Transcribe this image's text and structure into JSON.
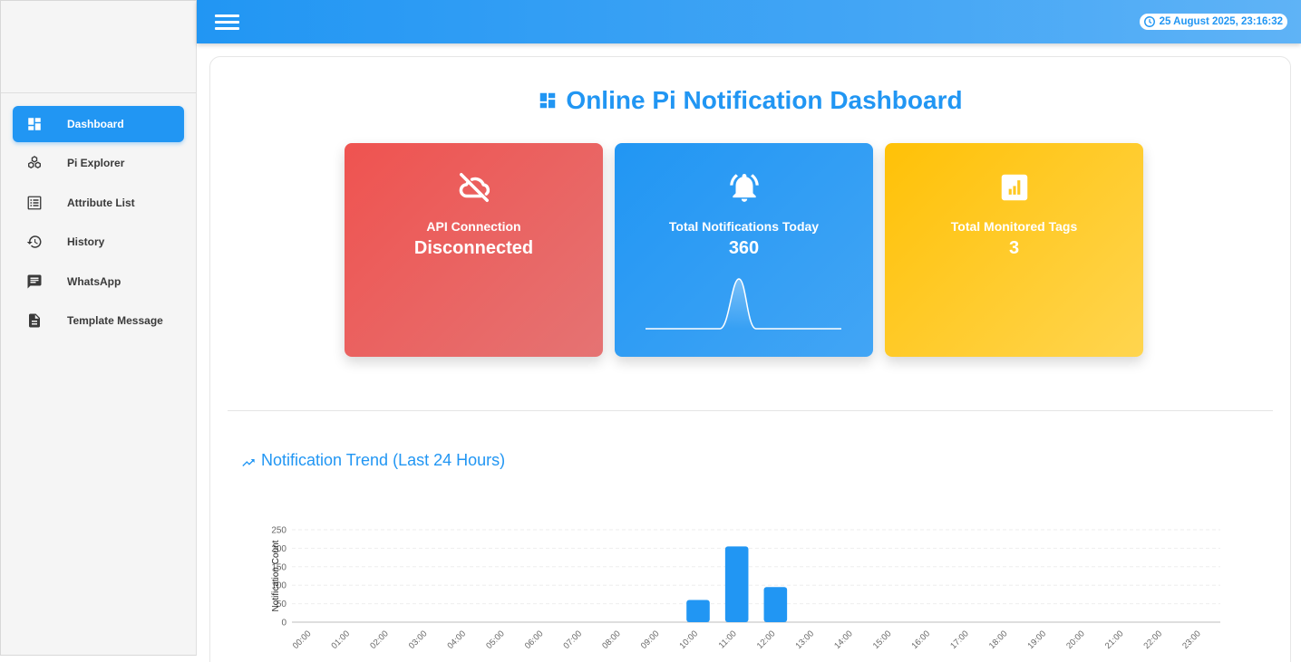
{
  "sidebar": {
    "items": [
      {
        "label": "Dashboard",
        "icon": "dashboard-icon",
        "active": true
      },
      {
        "label": "Pi Explorer",
        "icon": "hexagons-icon",
        "active": false
      },
      {
        "label": "Attribute List",
        "icon": "list-icon",
        "active": false
      },
      {
        "label": "History",
        "icon": "history-icon",
        "active": false
      },
      {
        "label": "WhatsApp",
        "icon": "chat-icon",
        "active": false
      },
      {
        "label": "Template Message",
        "icon": "document-icon",
        "active": false
      }
    ]
  },
  "topbar": {
    "datetime": "25 August 2025, 23:16:32"
  },
  "main": {
    "title": "Online Pi Notification Dashboard",
    "cards": {
      "api": {
        "label": "API Connection",
        "value": "Disconnected",
        "color": "#ef5350"
      },
      "notifications": {
        "label": "Total Notifications Today",
        "value": "360",
        "color": "#2196f3"
      },
      "tags": {
        "label": "Total Monitored Tags",
        "value": "3",
        "color": "#ffc107"
      }
    },
    "trend_title": "Notification Trend (Last 24 Hours)"
  },
  "chart_data": {
    "type": "bar",
    "title": "Notification Trend (Last 24 Hours)",
    "xlabel": "",
    "ylabel": "Notification Count",
    "ylim": [
      0,
      250
    ],
    "yticks": [
      0,
      50,
      100,
      150,
      200,
      250
    ],
    "categories": [
      "00:00",
      "01:00",
      "02:00",
      "03:00",
      "04:00",
      "05:00",
      "06:00",
      "07:00",
      "08:00",
      "09:00",
      "10:00",
      "11:00",
      "12:00",
      "13:00",
      "14:00",
      "15:00",
      "16:00",
      "17:00",
      "18:00",
      "19:00",
      "20:00",
      "21:00",
      "22:00",
      "23:00"
    ],
    "values": [
      0,
      0,
      0,
      0,
      0,
      0,
      0,
      0,
      0,
      0,
      60,
      205,
      95,
      0,
      0,
      0,
      0,
      0,
      0,
      0,
      0,
      0,
      0,
      0
    ],
    "color": "#2196f3",
    "grid": true
  }
}
